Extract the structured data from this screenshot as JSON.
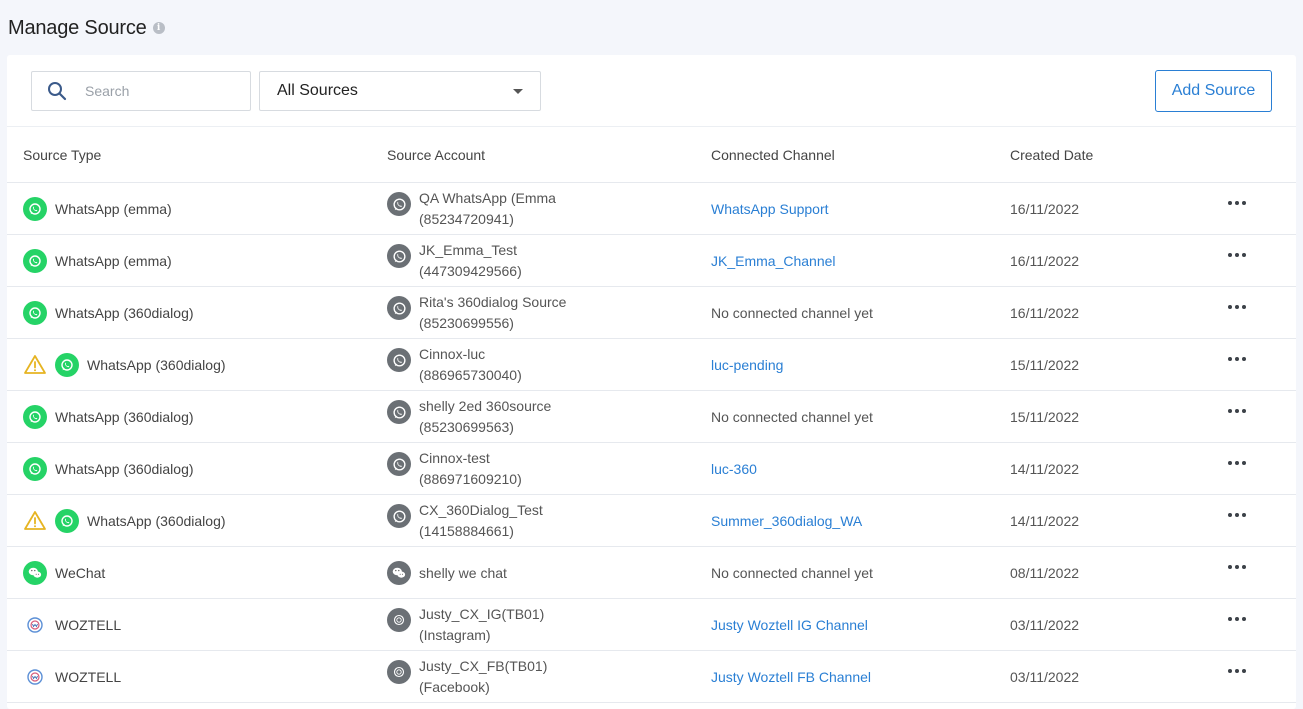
{
  "header": {
    "title": "Manage Source",
    "info_icon": "info-icon"
  },
  "toolbar": {
    "search_placeholder": "Search",
    "source_filter": "All Sources",
    "add_button": "Add Source"
  },
  "table": {
    "columns": [
      "Source Type",
      "Source Account",
      "Connected Channel",
      "Created Date"
    ],
    "rows": [
      {
        "warning": false,
        "icon": "whatsapp-icon",
        "type": "WhatsApp (emma)",
        "account_icon": "whatsapp-icon",
        "account_line1": "QA WhatsApp (Emma",
        "account_line2": "(85234720941)",
        "channel": "WhatsApp Support",
        "linked": true,
        "date": "16/11/2022"
      },
      {
        "warning": false,
        "icon": "whatsapp-icon",
        "type": "WhatsApp (emma)",
        "account_icon": "whatsapp-icon",
        "account_line1": "JK_Emma_Test",
        "account_line2": "(447309429566)",
        "channel": "JK_Emma_Channel",
        "linked": true,
        "date": "16/11/2022"
      },
      {
        "warning": false,
        "icon": "whatsapp-icon",
        "type": "WhatsApp (360dialog)",
        "account_icon": "whatsapp-icon",
        "account_line1": "Rita's 360dialog Source",
        "account_line2": "(85230699556)",
        "channel": "No connected channel yet",
        "linked": false,
        "date": "16/11/2022"
      },
      {
        "warning": true,
        "icon": "whatsapp-icon",
        "type": "WhatsApp (360dialog)",
        "account_icon": "whatsapp-icon",
        "account_line1": "Cinnox-luc",
        "account_line2": "(886965730040)",
        "channel": "luc-pending",
        "linked": true,
        "date": "15/11/2022"
      },
      {
        "warning": false,
        "icon": "whatsapp-icon",
        "type": "WhatsApp (360dialog)",
        "account_icon": "whatsapp-icon",
        "account_line1": "shelly 2ed 360source",
        "account_line2": "(85230699563)",
        "channel": "No connected channel yet",
        "linked": false,
        "date": "15/11/2022"
      },
      {
        "warning": false,
        "icon": "whatsapp-icon",
        "type": "WhatsApp (360dialog)",
        "account_icon": "whatsapp-icon",
        "account_line1": "Cinnox-test",
        "account_line2": "(886971609210)",
        "channel": "luc-360",
        "linked": true,
        "date": "14/11/2022"
      },
      {
        "warning": true,
        "icon": "whatsapp-icon",
        "type": "WhatsApp (360dialog)",
        "account_icon": "whatsapp-icon",
        "account_line1": "CX_360Dialog_Test",
        "account_line2": "(14158884661)",
        "channel": "Summer_360dialog_WA",
        "linked": true,
        "date": "14/11/2022"
      },
      {
        "warning": false,
        "icon": "wechat-icon",
        "type": "WeChat",
        "account_icon": "wechat-icon",
        "account_line1": "shelly we chat",
        "account_line2": "",
        "channel": "No connected channel yet",
        "linked": false,
        "date": "08/11/2022"
      },
      {
        "warning": false,
        "icon": "woztell-icon",
        "type": "WOZTELL",
        "account_icon": "woztell-icon",
        "account_line1": "Justy_CX_IG(TB01)",
        "account_line2": "(Instagram)",
        "channel": "Justy Woztell IG Channel",
        "linked": true,
        "date": "03/11/2022"
      },
      {
        "warning": false,
        "icon": "woztell-icon",
        "type": "WOZTELL",
        "account_icon": "woztell-icon",
        "account_line1": "Justy_CX_FB(TB01)",
        "account_line2": "(Facebook)",
        "channel": "Justy Woztell FB Channel",
        "linked": true,
        "date": "03/11/2022"
      }
    ]
  },
  "colors": {
    "accent": "#2a7fd4",
    "whatsapp": "#25d366",
    "warning": "#e6b422",
    "account_icon_bg": "#6b7075"
  }
}
